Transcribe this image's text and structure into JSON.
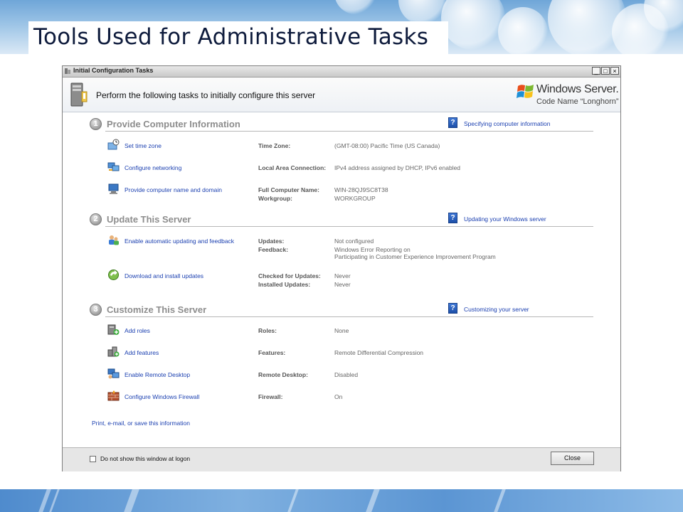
{
  "slide": {
    "title": "Tools Used for Administrative Tasks"
  },
  "window": {
    "title": "Initial Configuration Tasks",
    "controls": {
      "minimize": "_",
      "maximize": "□",
      "close": "×"
    },
    "header_text": "Perform the following tasks to initially configure this server",
    "logo_name": "Windows Server.",
    "logo_codename": "Code Name “Longhorn”"
  },
  "sections": [
    {
      "number": "1",
      "title": "Provide Computer Information",
      "help_link": "Specifying computer information",
      "tasks": [
        {
          "icon": "clock-icon",
          "label": "Set time zone",
          "props": [
            {
              "label": "Time Zone:",
              "value": "(GMT-08:00) Pacific Time (US  Canada)"
            }
          ]
        },
        {
          "icon": "network-icon",
          "label": "Configure networking",
          "props": [
            {
              "label": "Local Area Connection:",
              "value": "IPv4 address assigned by DHCP, IPv6 enabled"
            }
          ]
        },
        {
          "icon": "computer-icon",
          "label": "Provide computer name and domain",
          "props": [
            {
              "label": "Full Computer Name:",
              "value": "WIN-28QJ9SC8T38"
            },
            {
              "label": "Workgroup:",
              "value": "WORKGROUP"
            }
          ]
        }
      ]
    },
    {
      "number": "2",
      "title": "Update This Server",
      "help_link": "Updating your Windows server",
      "tasks": [
        {
          "icon": "users-icon",
          "label": "Enable automatic updating and feedback",
          "props": [
            {
              "label": "Updates:",
              "value": "Not configured"
            },
            {
              "label": "Feedback:",
              "value": "Windows Error Reporting on"
            }
          ],
          "extra_value": "Participating in Customer Experience Improvement Program"
        },
        {
          "icon": "update-icon",
          "label": "Download and install updates",
          "props": [
            {
              "label": "Checked for Updates:",
              "value": "Never"
            },
            {
              "label": "Installed Updates:",
              "value": "Never"
            }
          ]
        }
      ]
    },
    {
      "number": "3",
      "title": "Customize This Server",
      "help_link": "Customizing your server",
      "tasks": [
        {
          "icon": "add-roles-icon",
          "label": "Add roles",
          "props": [
            {
              "label": "Roles:",
              "value": "None"
            }
          ]
        },
        {
          "icon": "add-features-icon",
          "label": "Add features",
          "props": [
            {
              "label": "Features:",
              "value": "Remote Differential Compression"
            }
          ]
        },
        {
          "icon": "remote-desktop-icon",
          "label": "Enable Remote Desktop",
          "props": [
            {
              "label": "Remote Desktop:",
              "value": "Disabled"
            }
          ]
        },
        {
          "icon": "firewall-icon",
          "label": "Configure Windows Firewall",
          "props": [
            {
              "label": "Firewall:",
              "value": "On"
            }
          ]
        }
      ]
    }
  ],
  "print_link": "Print, e-mail, or save this information",
  "footer": {
    "checkbox_label": "Do not show this window at logon",
    "checkbox_checked": false,
    "close_label": "Close"
  },
  "colors": {
    "link": "#1a3fb0",
    "section_title": "#8d8d8d",
    "slide_title": "#0e1b3c",
    "slide_accent": "#6fa6d8"
  }
}
